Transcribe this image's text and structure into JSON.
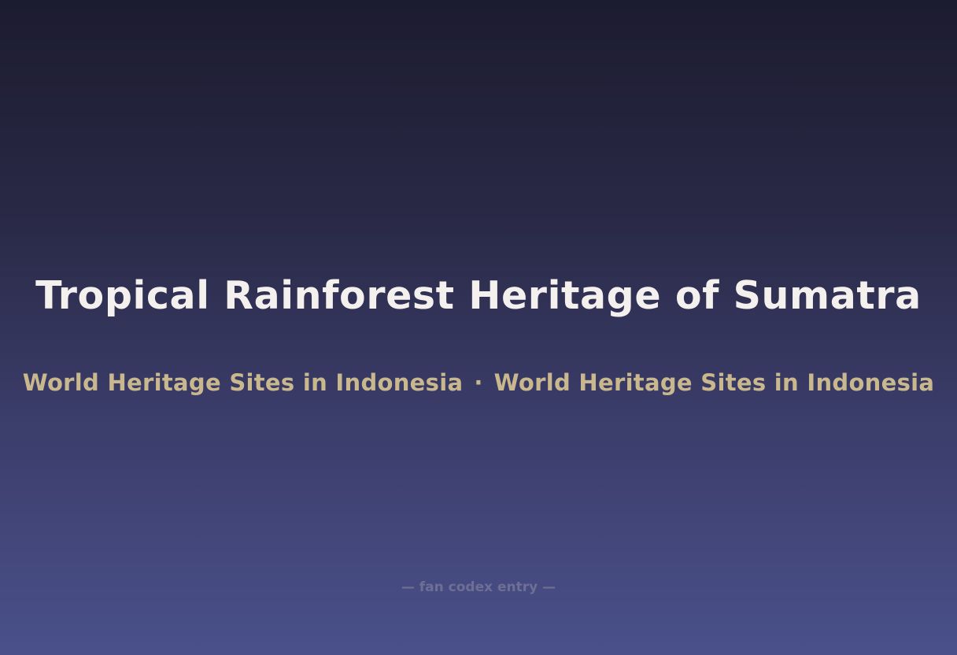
{
  "title": "Tropical Rainforest Heritage of Sumatra",
  "subtitle": {
    "left": "World Heritage Sites in Indonesia",
    "separator": "·",
    "right": "World Heritage Sites in Indonesia"
  },
  "footer": "— fan codex entry —",
  "colors": {
    "title": "#f4f0ee",
    "subtitle": "#c9b88e",
    "footer": "#6e6f95",
    "background_top": "#1c1b2f",
    "background_bottom": "#4a508a"
  }
}
